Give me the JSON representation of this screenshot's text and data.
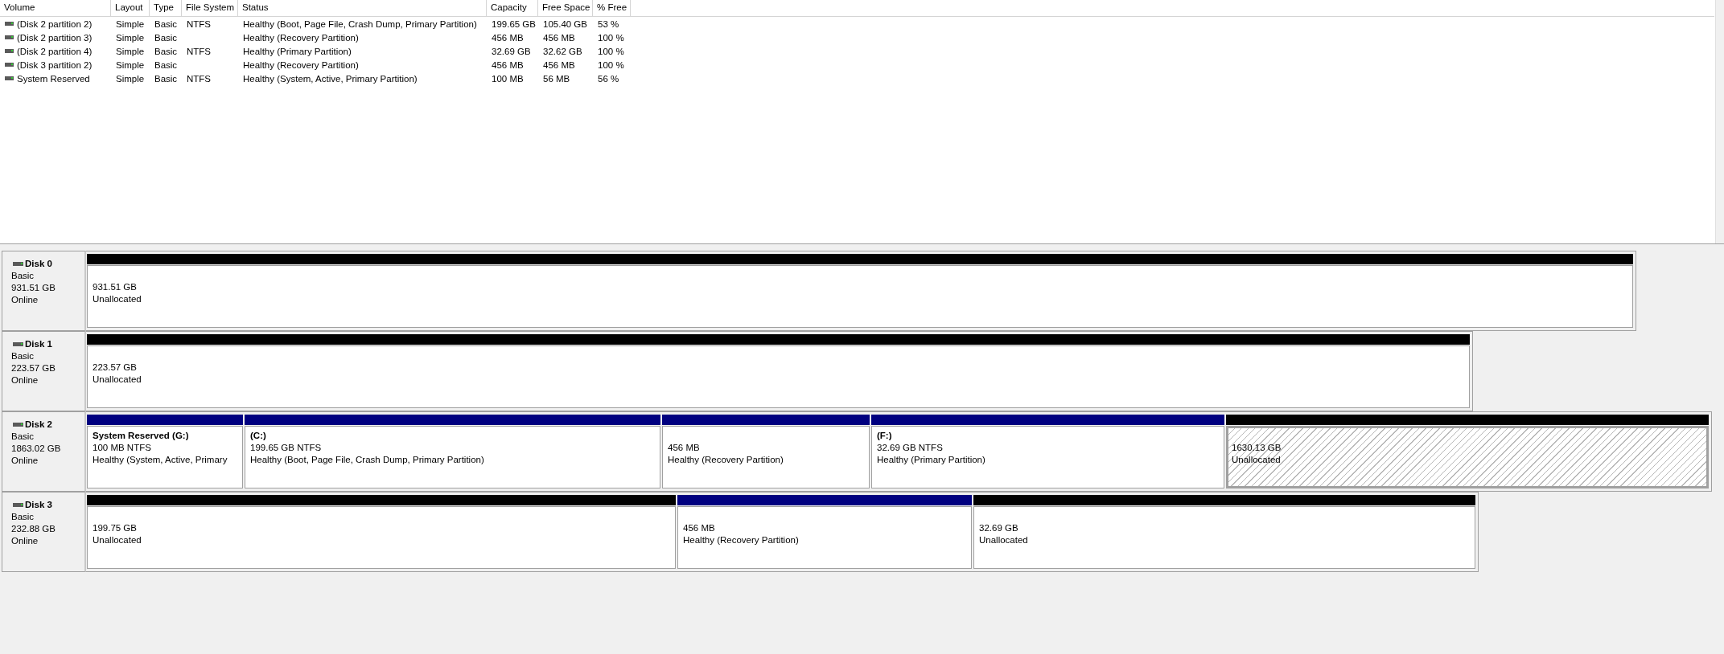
{
  "volume_table": {
    "columns": [
      "Volume",
      "Layout",
      "Type",
      "File System",
      "Status",
      "Capacity",
      "Free Space",
      "% Free"
    ],
    "rows": [
      {
        "cells": [
          "(Disk 2 partition 2)",
          "Simple",
          "Basic",
          "NTFS",
          "Healthy (Boot, Page File, Crash Dump, Primary Partition)",
          "199.65 GB",
          "105.40 GB",
          "53 %"
        ]
      },
      {
        "cells": [
          "(Disk 2 partition 3)",
          "Simple",
          "Basic",
          "",
          "Healthy (Recovery Partition)",
          "456 MB",
          "456 MB",
          "100 %"
        ]
      },
      {
        "cells": [
          "(Disk 2 partition 4)",
          "Simple",
          "Basic",
          "NTFS",
          "Healthy (Primary Partition)",
          "32.69 GB",
          "32.62 GB",
          "100 %"
        ]
      },
      {
        "cells": [
          "(Disk 3 partition 2)",
          "Simple",
          "Basic",
          "",
          "Healthy (Recovery Partition)",
          "456 MB",
          "456 MB",
          "100 %"
        ]
      },
      {
        "cells": [
          "System Reserved",
          "Simple",
          "Basic",
          "NTFS",
          "Healthy (System, Active, Primary Partition)",
          "100 MB",
          "56 MB",
          "56 %"
        ]
      }
    ]
  },
  "disks": [
    {
      "name": "Disk 0",
      "type": "Basic",
      "size": "931.51 GB",
      "status": "Online",
      "partitions": [
        {
          "kind": "unallocated",
          "selected": false,
          "size": "931.51 GB",
          "status": "Unallocated"
        }
      ]
    },
    {
      "name": "Disk 1",
      "type": "Basic",
      "size": "223.57 GB",
      "status": "Online",
      "partitions": [
        {
          "kind": "unallocated",
          "selected": false,
          "size": "223.57 GB",
          "status": "Unallocated"
        }
      ]
    },
    {
      "name": "Disk 2",
      "type": "Basic",
      "size": "1863.02 GB",
      "status": "Online",
      "partitions": [
        {
          "kind": "primary",
          "selected": false,
          "title": "System Reserved  (G:)",
          "size": "100 MB NTFS",
          "status": "Healthy (System, Active, Primary"
        },
        {
          "kind": "primary",
          "selected": false,
          "title": "(C:)",
          "size": "199.65 GB NTFS",
          "status": "Healthy (Boot, Page File, Crash Dump, Primary Partition)"
        },
        {
          "kind": "primary",
          "selected": false,
          "size": "456 MB",
          "status": "Healthy (Recovery Partition)"
        },
        {
          "kind": "primary",
          "selected": false,
          "title": "(F:)",
          "size": "32.69 GB NTFS",
          "status": "Healthy (Primary Partition)"
        },
        {
          "kind": "unallocated",
          "selected": true,
          "size": "1630.13 GB",
          "status": "Unallocated"
        }
      ]
    },
    {
      "name": "Disk 3",
      "type": "Basic",
      "size": "232.88 GB",
      "status": "Online",
      "partitions": [
        {
          "kind": "unallocated",
          "selected": false,
          "size": "199.75 GB",
          "status": "Unallocated"
        },
        {
          "kind": "primary",
          "selected": false,
          "size": "456 MB",
          "status": "Healthy (Recovery Partition)"
        },
        {
          "kind": "unallocated",
          "selected": false,
          "size": "32.69 GB",
          "status": "Unallocated"
        }
      ]
    }
  ]
}
